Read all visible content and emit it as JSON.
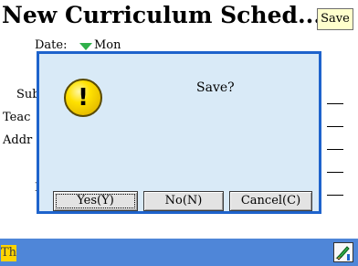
{
  "header": {
    "title": "New Curriculum Sched...",
    "save_label": "Save"
  },
  "form": {
    "date_label": "Date:",
    "date_value": "Mon",
    "subject_label": "Sub",
    "teacher_label": "Teac",
    "address_label": "Addr",
    "n_label": "N"
  },
  "dialog": {
    "message": "Save?",
    "icon": "warning-icon",
    "buttons": {
      "yes": "Yes(Y)",
      "no": "No(N)",
      "cancel": "Cancel(C)"
    }
  },
  "statusbar": {
    "day": "Th",
    "edit_icon": "pen-icon"
  },
  "colors": {
    "dialog_border": "#1e63cc",
    "dialog_bg": "#d9eaf7",
    "statusbar": "#4f86d8",
    "accent_green": "#2fb04a",
    "highlight_yellow": "#ffd400"
  }
}
